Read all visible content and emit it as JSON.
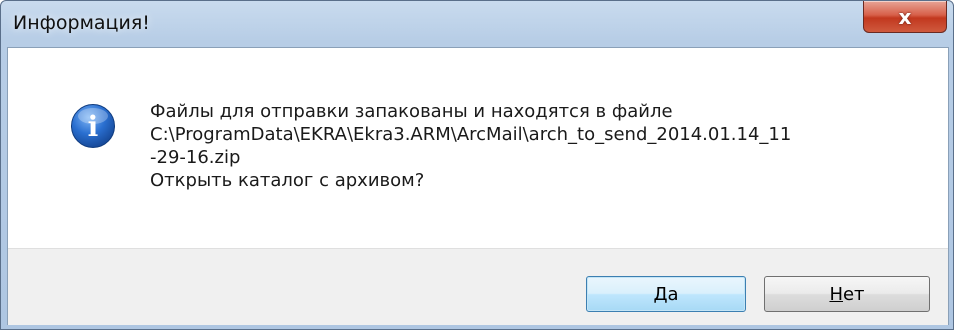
{
  "window": {
    "title": "Информация!",
    "close_glyph": "x"
  },
  "message": {
    "line1": "Файлы для отправки запакованы и находятся в файле",
    "line2": "C:\\ProgramData\\EKRA\\Ekra3.ARM\\ArcMail\\arch_to_send_2014.01.14_11",
    "line3": "-29-16.zip",
    "line4": "Открыть каталог с архивом?"
  },
  "icon": {
    "name": "information",
    "glyph": "i",
    "color": "#2a6fd0"
  },
  "buttons": {
    "yes_label": "Да",
    "no_mnemonic": "Н",
    "no_rest": "ет"
  },
  "colors": {
    "titlebar": "#b7cde6",
    "close": "#c94a32",
    "default_button_border": "#3c7fb1"
  }
}
